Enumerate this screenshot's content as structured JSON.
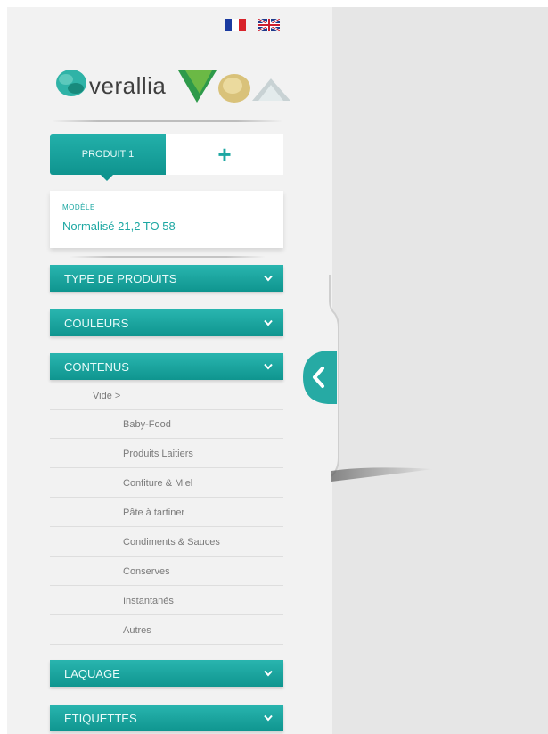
{
  "languages": [
    {
      "code": "fr",
      "icon": "flag-fr-icon"
    },
    {
      "code": "en",
      "icon": "flag-uk-icon"
    }
  ],
  "brand": {
    "name": "verallia"
  },
  "product_tabs": {
    "active_label": "PRODUIT 1",
    "add_label": "+"
  },
  "model": {
    "label": "MODÈLE",
    "value": "Normalisé 21,2 TO 58"
  },
  "accordions": {
    "type_produits": "TYPE DE PRODUITS",
    "couleurs": "COULEURS",
    "contenus": "CONTENUS",
    "laquage": "LAQUAGE",
    "etiquettes": "ETIQUETTES"
  },
  "contenus_submenu": {
    "vide": "Vide  >",
    "items": [
      "Baby-Food",
      "Produits Laitiers",
      "Confiture & Miel",
      "Pâte à tartiner",
      "Condiments & Sauces",
      "Conserves",
      "Instantanés",
      "Autres"
    ]
  },
  "colors": {
    "teal": "#1ca7a2",
    "teal_dark": "#0f948f",
    "sidebar_bg": "#f2f2f2",
    "panel_bg": "#e6e6e6"
  }
}
